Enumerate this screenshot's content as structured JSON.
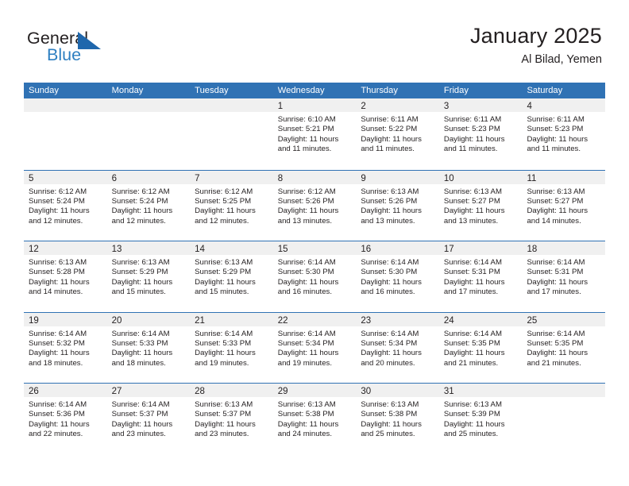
{
  "brand": {
    "name_top": "General",
    "name_bottom": "Blue",
    "triangle_color": "#1f67ac",
    "blue_color": "#2e7fc1"
  },
  "header": {
    "title": "January 2025",
    "location": "Al Bilad, Yemen"
  },
  "theme": {
    "header_bg": "#3072b4",
    "header_text": "#ffffff",
    "day_band_bg": "#f0f0f0",
    "text": "#231f20"
  },
  "calendar": {
    "weekdays": [
      "Sunday",
      "Monday",
      "Tuesday",
      "Wednesday",
      "Thursday",
      "Friday",
      "Saturday"
    ],
    "weeks": [
      [
        {
          "day": "",
          "sunrise": "",
          "sunset": "",
          "daylight_line1": "",
          "daylight_line2": ""
        },
        {
          "day": "",
          "sunrise": "",
          "sunset": "",
          "daylight_line1": "",
          "daylight_line2": ""
        },
        {
          "day": "",
          "sunrise": "",
          "sunset": "",
          "daylight_line1": "",
          "daylight_line2": ""
        },
        {
          "day": "1",
          "sunrise": "Sunrise: 6:10 AM",
          "sunset": "Sunset: 5:21 PM",
          "daylight_line1": "Daylight: 11 hours",
          "daylight_line2": "and 11 minutes."
        },
        {
          "day": "2",
          "sunrise": "Sunrise: 6:11 AM",
          "sunset": "Sunset: 5:22 PM",
          "daylight_line1": "Daylight: 11 hours",
          "daylight_line2": "and 11 minutes."
        },
        {
          "day": "3",
          "sunrise": "Sunrise: 6:11 AM",
          "sunset": "Sunset: 5:23 PM",
          "daylight_line1": "Daylight: 11 hours",
          "daylight_line2": "and 11 minutes."
        },
        {
          "day": "4",
          "sunrise": "Sunrise: 6:11 AM",
          "sunset": "Sunset: 5:23 PM",
          "daylight_line1": "Daylight: 11 hours",
          "daylight_line2": "and 11 minutes."
        }
      ],
      [
        {
          "day": "5",
          "sunrise": "Sunrise: 6:12 AM",
          "sunset": "Sunset: 5:24 PM",
          "daylight_line1": "Daylight: 11 hours",
          "daylight_line2": "and 12 minutes."
        },
        {
          "day": "6",
          "sunrise": "Sunrise: 6:12 AM",
          "sunset": "Sunset: 5:24 PM",
          "daylight_line1": "Daylight: 11 hours",
          "daylight_line2": "and 12 minutes."
        },
        {
          "day": "7",
          "sunrise": "Sunrise: 6:12 AM",
          "sunset": "Sunset: 5:25 PM",
          "daylight_line1": "Daylight: 11 hours",
          "daylight_line2": "and 12 minutes."
        },
        {
          "day": "8",
          "sunrise": "Sunrise: 6:12 AM",
          "sunset": "Sunset: 5:26 PM",
          "daylight_line1": "Daylight: 11 hours",
          "daylight_line2": "and 13 minutes."
        },
        {
          "day": "9",
          "sunrise": "Sunrise: 6:13 AM",
          "sunset": "Sunset: 5:26 PM",
          "daylight_line1": "Daylight: 11 hours",
          "daylight_line2": "and 13 minutes."
        },
        {
          "day": "10",
          "sunrise": "Sunrise: 6:13 AM",
          "sunset": "Sunset: 5:27 PM",
          "daylight_line1": "Daylight: 11 hours",
          "daylight_line2": "and 13 minutes."
        },
        {
          "day": "11",
          "sunrise": "Sunrise: 6:13 AM",
          "sunset": "Sunset: 5:27 PM",
          "daylight_line1": "Daylight: 11 hours",
          "daylight_line2": "and 14 minutes."
        }
      ],
      [
        {
          "day": "12",
          "sunrise": "Sunrise: 6:13 AM",
          "sunset": "Sunset: 5:28 PM",
          "daylight_line1": "Daylight: 11 hours",
          "daylight_line2": "and 14 minutes."
        },
        {
          "day": "13",
          "sunrise": "Sunrise: 6:13 AM",
          "sunset": "Sunset: 5:29 PM",
          "daylight_line1": "Daylight: 11 hours",
          "daylight_line2": "and 15 minutes."
        },
        {
          "day": "14",
          "sunrise": "Sunrise: 6:13 AM",
          "sunset": "Sunset: 5:29 PM",
          "daylight_line1": "Daylight: 11 hours",
          "daylight_line2": "and 15 minutes."
        },
        {
          "day": "15",
          "sunrise": "Sunrise: 6:14 AM",
          "sunset": "Sunset: 5:30 PM",
          "daylight_line1": "Daylight: 11 hours",
          "daylight_line2": "and 16 minutes."
        },
        {
          "day": "16",
          "sunrise": "Sunrise: 6:14 AM",
          "sunset": "Sunset: 5:30 PM",
          "daylight_line1": "Daylight: 11 hours",
          "daylight_line2": "and 16 minutes."
        },
        {
          "day": "17",
          "sunrise": "Sunrise: 6:14 AM",
          "sunset": "Sunset: 5:31 PM",
          "daylight_line1": "Daylight: 11 hours",
          "daylight_line2": "and 17 minutes."
        },
        {
          "day": "18",
          "sunrise": "Sunrise: 6:14 AM",
          "sunset": "Sunset: 5:31 PM",
          "daylight_line1": "Daylight: 11 hours",
          "daylight_line2": "and 17 minutes."
        }
      ],
      [
        {
          "day": "19",
          "sunrise": "Sunrise: 6:14 AM",
          "sunset": "Sunset: 5:32 PM",
          "daylight_line1": "Daylight: 11 hours",
          "daylight_line2": "and 18 minutes."
        },
        {
          "day": "20",
          "sunrise": "Sunrise: 6:14 AM",
          "sunset": "Sunset: 5:33 PM",
          "daylight_line1": "Daylight: 11 hours",
          "daylight_line2": "and 18 minutes."
        },
        {
          "day": "21",
          "sunrise": "Sunrise: 6:14 AM",
          "sunset": "Sunset: 5:33 PM",
          "daylight_line1": "Daylight: 11 hours",
          "daylight_line2": "and 19 minutes."
        },
        {
          "day": "22",
          "sunrise": "Sunrise: 6:14 AM",
          "sunset": "Sunset: 5:34 PM",
          "daylight_line1": "Daylight: 11 hours",
          "daylight_line2": "and 19 minutes."
        },
        {
          "day": "23",
          "sunrise": "Sunrise: 6:14 AM",
          "sunset": "Sunset: 5:34 PM",
          "daylight_line1": "Daylight: 11 hours",
          "daylight_line2": "and 20 minutes."
        },
        {
          "day": "24",
          "sunrise": "Sunrise: 6:14 AM",
          "sunset": "Sunset: 5:35 PM",
          "daylight_line1": "Daylight: 11 hours",
          "daylight_line2": "and 21 minutes."
        },
        {
          "day": "25",
          "sunrise": "Sunrise: 6:14 AM",
          "sunset": "Sunset: 5:35 PM",
          "daylight_line1": "Daylight: 11 hours",
          "daylight_line2": "and 21 minutes."
        }
      ],
      [
        {
          "day": "26",
          "sunrise": "Sunrise: 6:14 AM",
          "sunset": "Sunset: 5:36 PM",
          "daylight_line1": "Daylight: 11 hours",
          "daylight_line2": "and 22 minutes."
        },
        {
          "day": "27",
          "sunrise": "Sunrise: 6:14 AM",
          "sunset": "Sunset: 5:37 PM",
          "daylight_line1": "Daylight: 11 hours",
          "daylight_line2": "and 23 minutes."
        },
        {
          "day": "28",
          "sunrise": "Sunrise: 6:13 AM",
          "sunset": "Sunset: 5:37 PM",
          "daylight_line1": "Daylight: 11 hours",
          "daylight_line2": "and 23 minutes."
        },
        {
          "day": "29",
          "sunrise": "Sunrise: 6:13 AM",
          "sunset": "Sunset: 5:38 PM",
          "daylight_line1": "Daylight: 11 hours",
          "daylight_line2": "and 24 minutes."
        },
        {
          "day": "30",
          "sunrise": "Sunrise: 6:13 AM",
          "sunset": "Sunset: 5:38 PM",
          "daylight_line1": "Daylight: 11 hours",
          "daylight_line2": "and 25 minutes."
        },
        {
          "day": "31",
          "sunrise": "Sunrise: 6:13 AM",
          "sunset": "Sunset: 5:39 PM",
          "daylight_line1": "Daylight: 11 hours",
          "daylight_line2": "and 25 minutes."
        },
        {
          "day": "",
          "sunrise": "",
          "sunset": "",
          "daylight_line1": "",
          "daylight_line2": ""
        }
      ]
    ]
  }
}
